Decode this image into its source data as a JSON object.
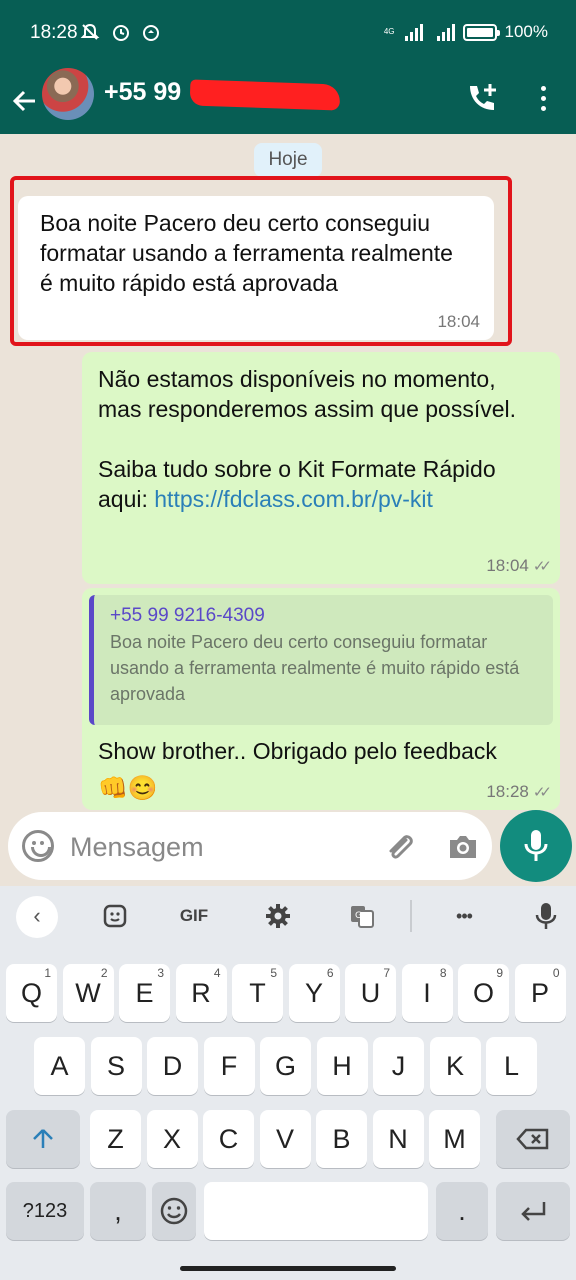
{
  "status_bar": {
    "time": "18:28",
    "network": "4G",
    "battery": "100%",
    "battery_level": 1.0
  },
  "header": {
    "contact_name": "+55 99"
  },
  "chat": {
    "date_chip": "Hoje",
    "incoming": {
      "text": "Boa noite Pacero deu certo conseguiu formatar usando a ferramenta realmente é muito rápido está aprovada",
      "time": "18:04"
    },
    "auto_reply": {
      "line1": "Não estamos disponíveis no momento, mas responderemos assim que possível.",
      "line2": "Saiba tudo sobre o Kit Formate Rápido aqui: ",
      "link": "https://fdclass.com.br/pv-kit",
      "time": "18:04",
      "ticks": "✓✓"
    },
    "reply": {
      "quote_author": "+55 99 9216-4309",
      "quote_text": "Boa noite Pacero deu certo conseguiu formatar usando a ferramenta realmente é muito rápido está aprovada",
      "text": "Show brother.. Obrigado pelo feedback ",
      "emojis": "👊😊",
      "time": "18:28",
      "ticks": "✓✓"
    }
  },
  "composer": {
    "placeholder": "Mensagem"
  },
  "keyboard": {
    "toolbar": {
      "gif": "GIF",
      "more": "•••"
    },
    "row1": [
      {
        "k": "Q",
        "n": "1"
      },
      {
        "k": "W",
        "n": "2"
      },
      {
        "k": "E",
        "n": "3"
      },
      {
        "k": "R",
        "n": "4"
      },
      {
        "k": "T",
        "n": "5"
      },
      {
        "k": "Y",
        "n": "6"
      },
      {
        "k": "U",
        "n": "7"
      },
      {
        "k": "I",
        "n": "8"
      },
      {
        "k": "O",
        "n": "9"
      },
      {
        "k": "P",
        "n": "0"
      }
    ],
    "row2": [
      "A",
      "S",
      "D",
      "F",
      "G",
      "H",
      "J",
      "K",
      "L"
    ],
    "row3": [
      "Z",
      "X",
      "C",
      "V",
      "B",
      "N",
      "M"
    ],
    "row4": {
      "symbols": "?123",
      "comma": ",",
      "period": "."
    }
  }
}
